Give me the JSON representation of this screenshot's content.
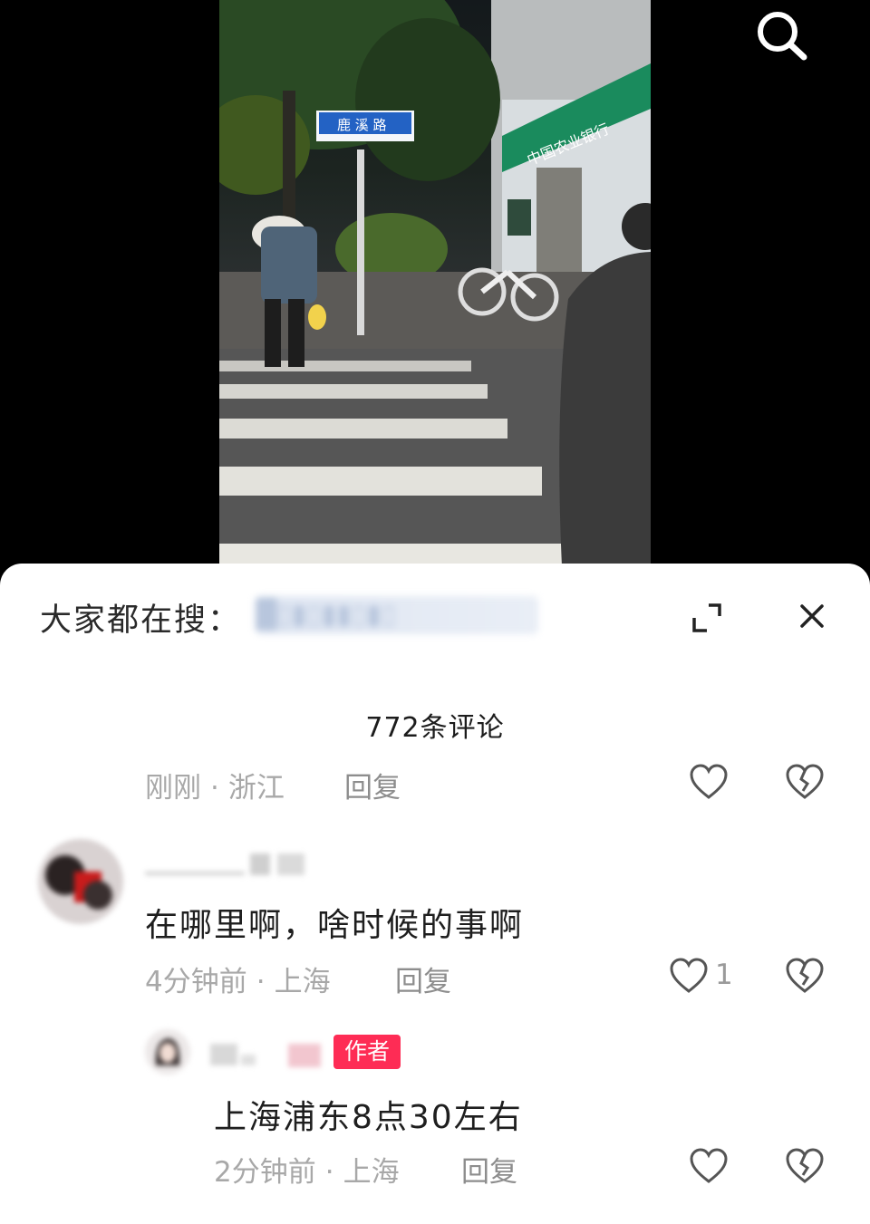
{
  "search_prompt": {
    "label": "大家都在搜：",
    "term": "█▯▮▯▮▮▯▮▯"
  },
  "comments_header": {
    "count_text": "772条评论"
  },
  "comments": [
    {
      "time": "刚刚",
      "location": "浙江",
      "reply_label": "回复",
      "likes": ""
    },
    {
      "text": "在哪里啊，啥时候的事啊",
      "time": "4分钟前",
      "location": "上海",
      "reply_label": "回复",
      "likes": "1",
      "replies": [
        {
          "author_badge": "作者",
          "text": "上海浦东8点30左右",
          "time": "2分钟前",
          "location": "上海",
          "reply_label": "回复",
          "likes": ""
        }
      ]
    }
  ],
  "icons": {
    "search": "search-icon",
    "expand": "expand-icon",
    "close": "close-icon",
    "like": "heart-icon",
    "dislike": "broken-heart-icon"
  },
  "colors": {
    "badge": "#fe2c55",
    "meta_text": "#a8a8a8",
    "panel_bg": "#ffffff",
    "video_bg": "#000000"
  }
}
